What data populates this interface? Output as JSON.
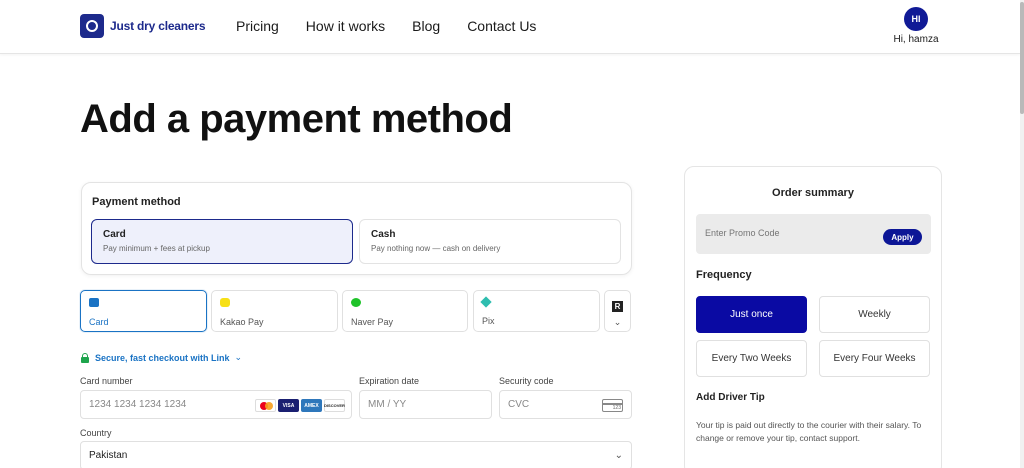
{
  "header": {
    "logo_text": "Just dry cleaners",
    "nav": [
      "Pricing",
      "How it works",
      "Blog",
      "Contact Us"
    ],
    "user_initials": "HI",
    "greeting": "Hi, hamza"
  },
  "page": {
    "title": "Add a payment method"
  },
  "payment_method": {
    "label": "Payment method",
    "options": [
      {
        "title": "Card",
        "subtitle": "Pay minimum + fees at pickup",
        "selected": true
      },
      {
        "title": "Cash",
        "subtitle": "Pay nothing now — cash on delivery",
        "selected": false
      }
    ]
  },
  "method_tabs": [
    {
      "label": "Card",
      "icon": "card-icon",
      "active": true
    },
    {
      "label": "Kakao Pay",
      "icon": "kakao-pay-icon",
      "active": false
    },
    {
      "label": "Naver Pay",
      "icon": "naver-pay-icon",
      "active": false
    },
    {
      "label": "Pix",
      "icon": "pix-icon",
      "active": false
    }
  ],
  "more_tab": {
    "glyph": "R",
    "chevron": "⌄"
  },
  "link": {
    "text": "Secure, fast checkout with Link",
    "chevron": "⌄"
  },
  "form": {
    "card_number": {
      "label": "Card number",
      "placeholder": "1234 1234 1234 1234"
    },
    "expiry": {
      "label": "Expiration date",
      "placeholder": "MM / YY"
    },
    "cvc": {
      "label": "Security code",
      "placeholder": "CVC",
      "icon_text": "123"
    },
    "country": {
      "label": "Country",
      "value": "Pakistan"
    },
    "card_brands": [
      "mastercard",
      "VISA",
      "AMEX",
      "DISCOVER"
    ]
  },
  "summary": {
    "title": "Order summary",
    "promo_placeholder": "Enter Promo Code",
    "apply_label": "Apply",
    "frequency_label": "Frequency",
    "frequencies": [
      {
        "label": "Just once",
        "selected": true
      },
      {
        "label": "Weekly",
        "selected": false
      },
      {
        "label": "Every Two Weeks",
        "selected": false
      },
      {
        "label": "Every Four Weeks",
        "selected": false
      }
    ],
    "tip_label": "Add Driver Tip",
    "tip_description": "Your tip is paid out directly to the courier with their salary. To change or remove your tip, contact support."
  },
  "colors": {
    "brand": "#1d2a8c",
    "primary_button": "#0c1696",
    "link_blue": "#1a73c4",
    "secure_green": "#1ea54d"
  }
}
